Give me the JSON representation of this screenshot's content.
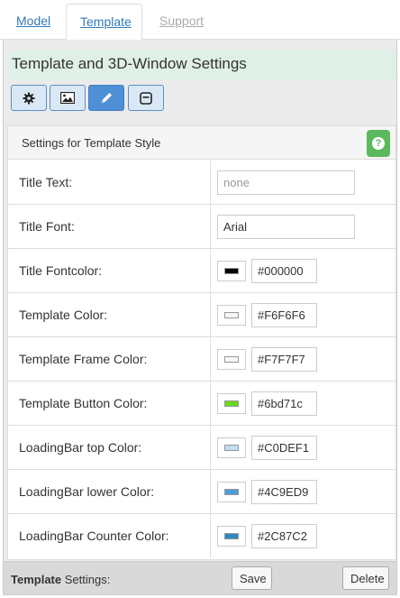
{
  "tabs": [
    {
      "label": "Model"
    },
    {
      "label": "Template"
    },
    {
      "label": "Support"
    }
  ],
  "panel": {
    "title": "Template and 3D-Window Settings",
    "toolbar_icons": [
      "gear-icon",
      "image-icon",
      "pencil-icon",
      "window-icon"
    ]
  },
  "settings": {
    "heading": "Settings for Template Style",
    "help_label": "?",
    "rows": [
      {
        "label": "Title Text:",
        "value": "",
        "placeholder": "none"
      },
      {
        "label": "Title Font:",
        "value": "Arial"
      },
      {
        "label": "Title Fontcolor:",
        "hex": "#000000",
        "color": "#000000"
      },
      {
        "label": "Template Color:",
        "hex": "#F6F6F6",
        "color": "#F6F6F6"
      },
      {
        "label": "Template Frame Color:",
        "hex": "#F7F7F7",
        "color": "#F7F7F7"
      },
      {
        "label": "Template Button Color:",
        "hex": "#6bd71c",
        "color": "#6bd71c"
      },
      {
        "label": "LoadingBar top Color:",
        "hex": "#C0DEF1",
        "color": "#C0DEF1"
      },
      {
        "label": "LoadingBar lower Color:",
        "hex": "#4C9ED9",
        "color": "#4C9ED9"
      },
      {
        "label": "LoadingBar Counter Color:",
        "hex": "#2C87C2",
        "color": "#2C87C2"
      }
    ]
  },
  "footer": {
    "label_bold": "Template",
    "label_rest": " Settings:",
    "save_label": "Save",
    "delete_label": "Delete"
  }
}
